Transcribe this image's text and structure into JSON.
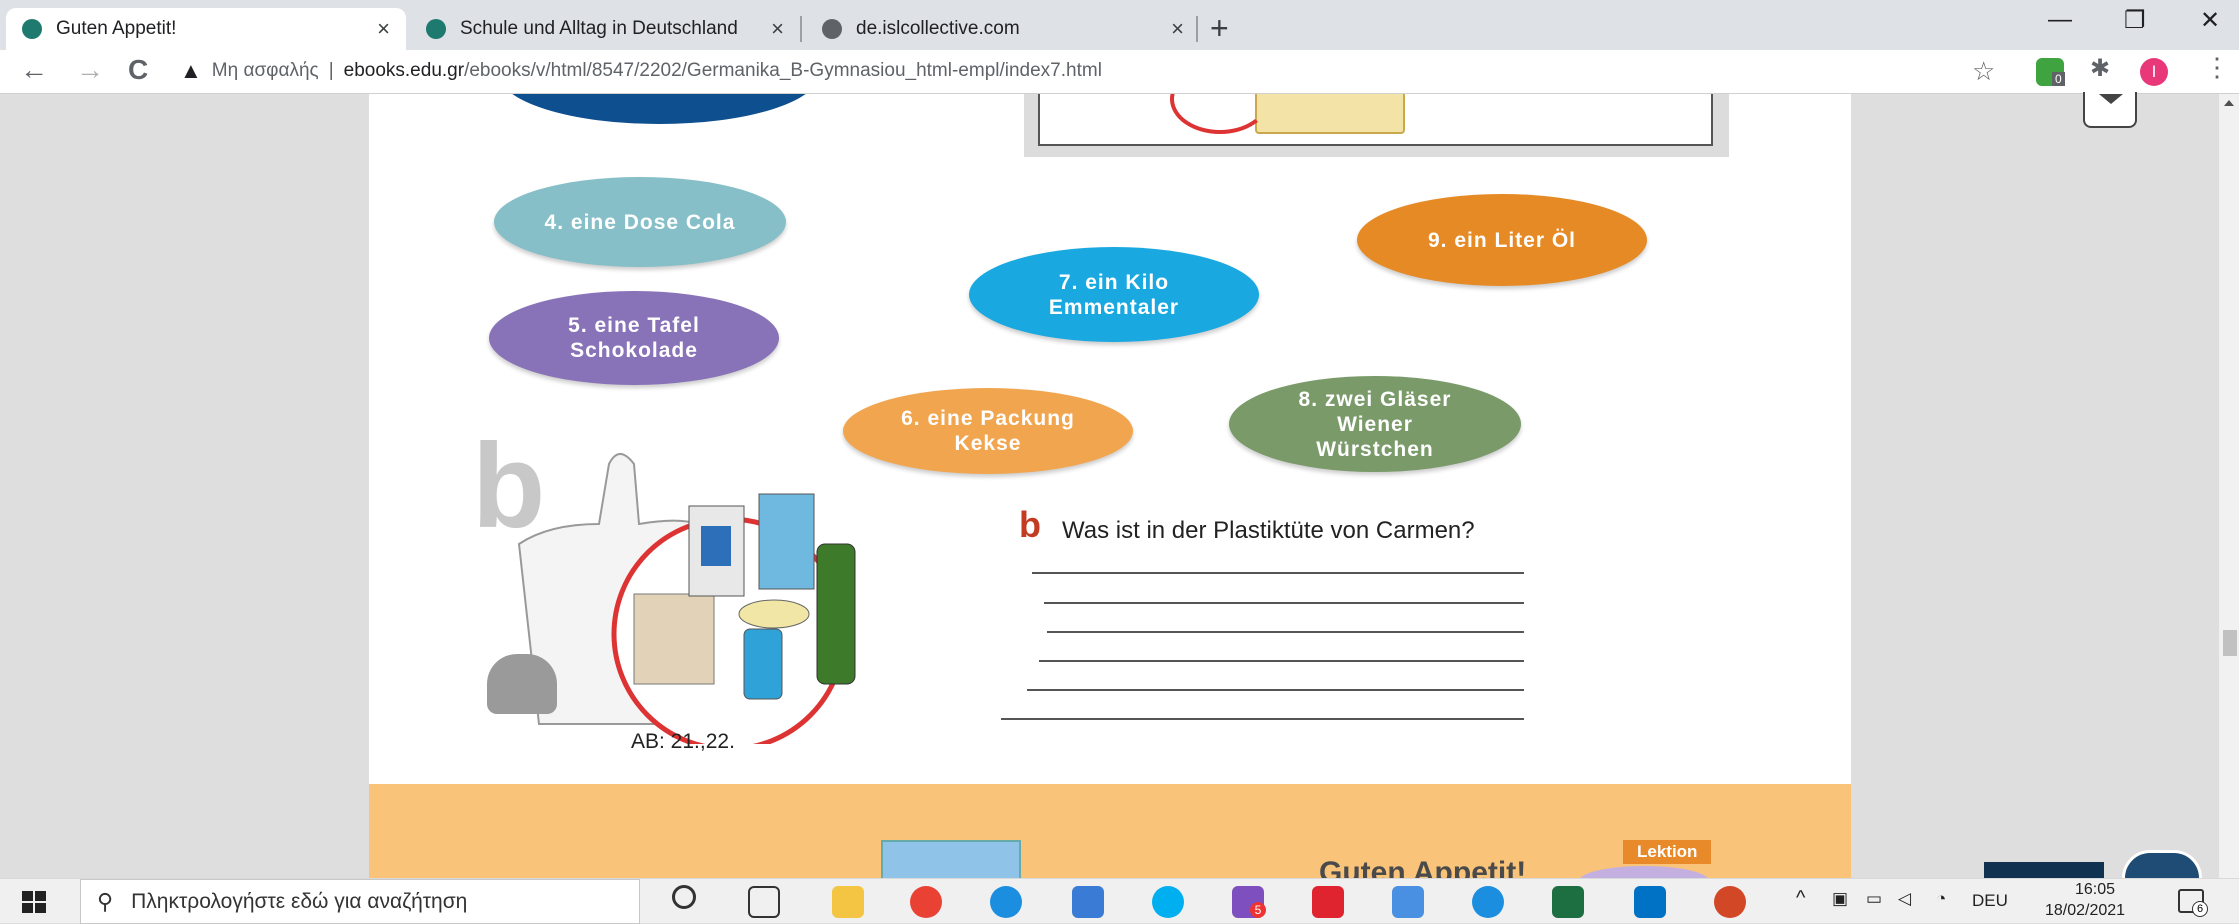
{
  "browser": {
    "tabs": [
      {
        "title": "Guten Appetit!",
        "active": true,
        "favicon_color": "#1e7a6e"
      },
      {
        "title": "Schule und Alltag in Deutschland",
        "active": false,
        "favicon_color": "#1e7a6e"
      },
      {
        "title": "de.islcollective.com",
        "active": false,
        "favicon_color": "#5f6368"
      }
    ],
    "tab_close": "×",
    "new_tab": "+",
    "window_controls": {
      "minimize": "—",
      "restore": "❐",
      "close": "✕"
    },
    "nav": {
      "back": "←",
      "forward": "→",
      "reload": "C"
    },
    "security_label": "Μη ασφαλής",
    "security_sep": "|",
    "url_host": "ebooks.edu.gr",
    "url_path": "/ebooks/v/html/8547/2202/Germanika_B-Gymnasiou_html-empl/index7.html",
    "star": "☆",
    "profile_initial": "I",
    "extension_badge": "0"
  },
  "page": {
    "items": [
      {
        "label": "4. eine Dose Cola",
        "color": "#86bfc7"
      },
      {
        "label": "5. eine Tafel Schokolade",
        "color": "#8872b8"
      },
      {
        "label": "6. eine Packung Kekse",
        "color": "#f2a54f"
      },
      {
        "label": "7. ein Kilo Emmentaler",
        "color": "#1aa8e0"
      },
      {
        "label": "8. zwei Gläser Wiener Würstchen",
        "color": "#7a9a6a"
      },
      {
        "label": "9. ein Liter Öl",
        "color": "#e68a26"
      }
    ],
    "section_letter": "b",
    "question_letter": "b",
    "question": "Was ist in der Plastiktüte von Carmen?",
    "ab_ref": "AB: 21.,22.",
    "footer_title": "Guten Appetit!",
    "lektion_label": "Lektion"
  },
  "taskbar": {
    "search_placeholder": "Πληκτρολογήστε εδώ για αναζήτηση",
    "apps": [
      {
        "name": "cortana",
        "color": "#333333"
      },
      {
        "name": "task-view",
        "color": "#333333"
      },
      {
        "name": "file-explorer",
        "color": "#f4c542"
      },
      {
        "name": "chrome",
        "color": "#e94235"
      },
      {
        "name": "edge",
        "color": "#1b8ee0"
      },
      {
        "name": "network",
        "color": "#3a7bd5"
      },
      {
        "name": "skype",
        "color": "#00aff0"
      },
      {
        "name": "viber",
        "color": "#7d4fbf"
      },
      {
        "name": "yd",
        "color": "#e0242f"
      },
      {
        "name": "notes",
        "color": "#4a90e2"
      },
      {
        "name": "globe",
        "color": "#1b8ee0"
      },
      {
        "name": "excel",
        "color": "#1d6f42"
      },
      {
        "name": "outlook",
        "color": "#0072c6"
      },
      {
        "name": "powerpoint",
        "color": "#d24726"
      }
    ],
    "viber_badge": "5",
    "language": "DEU",
    "time": "16:05",
    "date": "18/02/2021",
    "notification_count": "6"
  }
}
